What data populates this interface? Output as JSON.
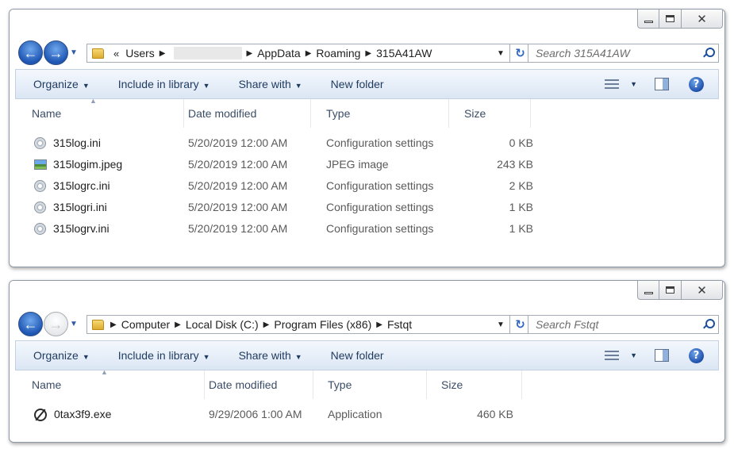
{
  "windows": [
    {
      "address": {
        "overflow": "«",
        "crumbs": [
          "Users",
          "AppData",
          "Roaming",
          "315A41AW"
        ]
      },
      "search_placeholder": "Search 315A41AW",
      "toolbar": {
        "organize": "Organize",
        "include": "Include in library",
        "share": "Share with",
        "new_folder": "New folder"
      },
      "columns": {
        "name": "Name",
        "date": "Date modified",
        "type": "Type",
        "size": "Size"
      },
      "files": [
        {
          "icon": "config-file-icon",
          "name": "315log.ini",
          "date": "5/20/2019 12:00 AM",
          "type": "Configuration settings",
          "size": "0 KB"
        },
        {
          "icon": "jpeg-image-icon",
          "name": "315logim.jpeg",
          "date": "5/20/2019 12:00 AM",
          "type": "JPEG image",
          "size": "243 KB"
        },
        {
          "icon": "config-file-icon",
          "name": "315logrc.ini",
          "date": "5/20/2019 12:00 AM",
          "type": "Configuration settings",
          "size": "2 KB"
        },
        {
          "icon": "config-file-icon",
          "name": "315logri.ini",
          "date": "5/20/2019 12:00 AM",
          "type": "Configuration settings",
          "size": "1 KB"
        },
        {
          "icon": "config-file-icon",
          "name": "315logrv.ini",
          "date": "5/20/2019 12:00 AM",
          "type": "Configuration settings",
          "size": "1 KB"
        }
      ]
    },
    {
      "address": {
        "crumbs": [
          "Computer",
          "Local Disk (C:)",
          "Program Files (x86)",
          "Fstqt"
        ]
      },
      "search_placeholder": "Search Fstqt",
      "toolbar": {
        "organize": "Organize",
        "include": "Include in library",
        "share": "Share with",
        "new_folder": "New folder"
      },
      "columns": {
        "name": "Name",
        "date": "Date modified",
        "type": "Type",
        "size": "Size"
      },
      "files": [
        {
          "icon": "application-icon",
          "name": "0tax3f9.exe",
          "date": "9/29/2006 1:00 AM",
          "type": "Application",
          "size": "460 KB"
        }
      ]
    }
  ]
}
